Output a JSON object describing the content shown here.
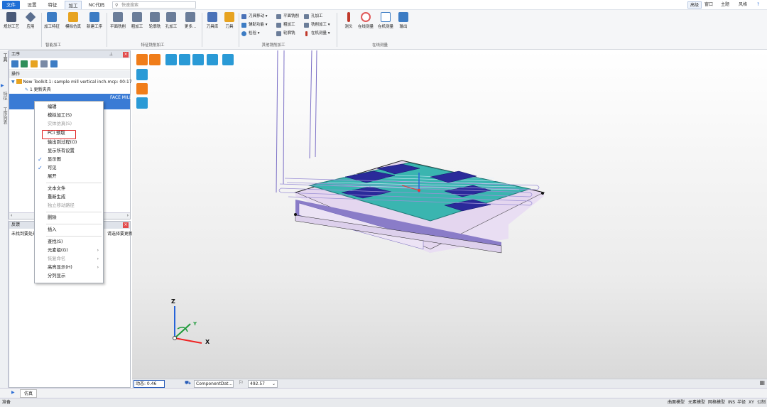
{
  "menu_tabs": [
    "文件",
    "设置",
    "特征",
    "加工",
    "NC代码"
  ],
  "search_placeholder": "快速搜索",
  "top_right": [
    "高级",
    "窗口",
    "主题",
    "风格",
    "?"
  ],
  "ribbon": {
    "big": [
      {
        "label": "规划工艺",
        "color": "#4a5a78"
      },
      {
        "label": "应用",
        "color": "#5b6f8f"
      },
      {
        "label": "加工特征",
        "color": "#3c7cc4"
      },
      {
        "label": "模拟仿真",
        "color": "#e7a320"
      },
      {
        "label": "新建工序",
        "color": "#3c7cc4"
      },
      {
        "label": "平面铣削",
        "color": "#6b7d99"
      },
      {
        "label": "粗加工",
        "color": "#6b7d99"
      },
      {
        "label": "轮廓铣",
        "color": "#6b7d99"
      },
      {
        "label": "孔加工",
        "color": "#6b7d99"
      },
      {
        "label": "更多...",
        "color": "#6b7d99"
      },
      {
        "label": "刀具库",
        "color": "#4a72b8"
      },
      {
        "label": "刀具",
        "color": "#e7a320"
      }
    ],
    "small": [
      {
        "label": "刀具移动 ▾",
        "color": "#4a72b8"
      },
      {
        "label": "辅助功能 ▾",
        "color": "#3c7cc4"
      },
      {
        "label": "检验 ▾",
        "color": "#3c7cc4"
      },
      {
        "label": "平面铣削",
        "color": "#6b7d99"
      },
      {
        "label": "粗加工",
        "color": "#6b7d99"
      },
      {
        "label": "轮廓铣",
        "color": "#6b7d99"
      },
      {
        "label": "孔加工",
        "color": "#6b7d99"
      },
      {
        "label": "铣削加工 ▾",
        "color": "#6b7d99"
      },
      {
        "label": "在机测量 ▾",
        "color": "#c0392b"
      }
    ],
    "probe": [
      {
        "label": "测头",
        "color": "#c0392b"
      },
      {
        "label": "在线测量",
        "color": "#e05a5a"
      },
      {
        "label": "在机测量",
        "color": "#3c7cc4"
      },
      {
        "label": "输出",
        "color": "#3c7cc4"
      }
    ],
    "groups": [
      "智能加工",
      "特征铣削加工",
      "其他铣削加工",
      "在线测量"
    ]
  },
  "left_strip": [
    "工具",
    "特征",
    "工序列表"
  ],
  "ops_panel": {
    "title": "工序",
    "tree_header": "操作",
    "toolkit": "New Toolkit.1: sample mill vertical inch.mcp: 00:17",
    "item1": "1 更新夹具",
    "item2": "FACE MILL"
  },
  "context_menu": [
    {
      "label": "编辑",
      "dis": false
    },
    {
      "label": "模拟加工(S)",
      "dis": false
    },
    {
      "label": "实体仿真(S)",
      "dis": true
    },
    {
      "label": "PCI 预取",
      "dis": false
    },
    {
      "label": "输出到过程(O)",
      "dis": false
    },
    {
      "label": "显示所有设置",
      "dis": false
    },
    {
      "label": "显示图",
      "dis": false,
      "chk": true
    },
    {
      "label": "可见",
      "dis": false,
      "chk": true
    },
    {
      "label": "展开",
      "dis": false
    },
    {
      "label": "文本文件",
      "dis": false
    },
    {
      "label": "重新生成",
      "dis": false
    },
    {
      "label": "独立移动路径",
      "dis": true
    },
    {
      "label": "删除",
      "dis": false
    },
    {
      "label": "插入",
      "dis": false
    },
    {
      "label": "查找(S)",
      "dis": false
    },
    {
      "label": "元素组(G)",
      "dis": false,
      "sub": true
    },
    {
      "label": "恢复命名",
      "dis": true,
      "sub": true
    },
    {
      "label": "高亮显示(H)",
      "dis": false,
      "sub": true
    },
    {
      "label": "分列显示",
      "dis": false
    }
  ],
  "output_panel": {
    "title": "反馈",
    "text": "未找到要处理的元素",
    "text2": "请选择要更新的元素"
  },
  "axes": {
    "x": "X",
    "y": "Y",
    "z": "Z"
  },
  "status": {
    "anim": "动态: 0.46",
    "component": "ComponentDat...",
    "value": "492.57"
  },
  "bottom_tab": "仿真",
  "footer_left": "准备",
  "footer_right": [
    "曲面模型",
    "元素模型",
    "网格模型",
    "INS",
    "半径",
    "XY",
    "公制"
  ]
}
